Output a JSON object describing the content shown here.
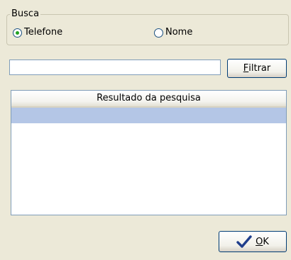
{
  "search_group": {
    "title": "Busca",
    "options": [
      {
        "label": "Telefone",
        "selected": true
      },
      {
        "label": "Nome",
        "selected": false
      }
    ]
  },
  "filter": {
    "value": "",
    "button_label_prefix": "",
    "button_mnemonic": "F",
    "button_label_rest": "iltrar"
  },
  "results": {
    "column_header": "Resultado da pesquisa",
    "rows": [
      ""
    ]
  },
  "ok_button": {
    "mnemonic": "O",
    "rest": "K",
    "icon": "checkmark-icon",
    "icon_color": "#1F3E8C"
  },
  "colors": {
    "window_bg": "#ECE9D8",
    "selection_row": "#B4C6E6",
    "radio_dot": "#21A121",
    "border_blue": "#7F9DB9"
  }
}
